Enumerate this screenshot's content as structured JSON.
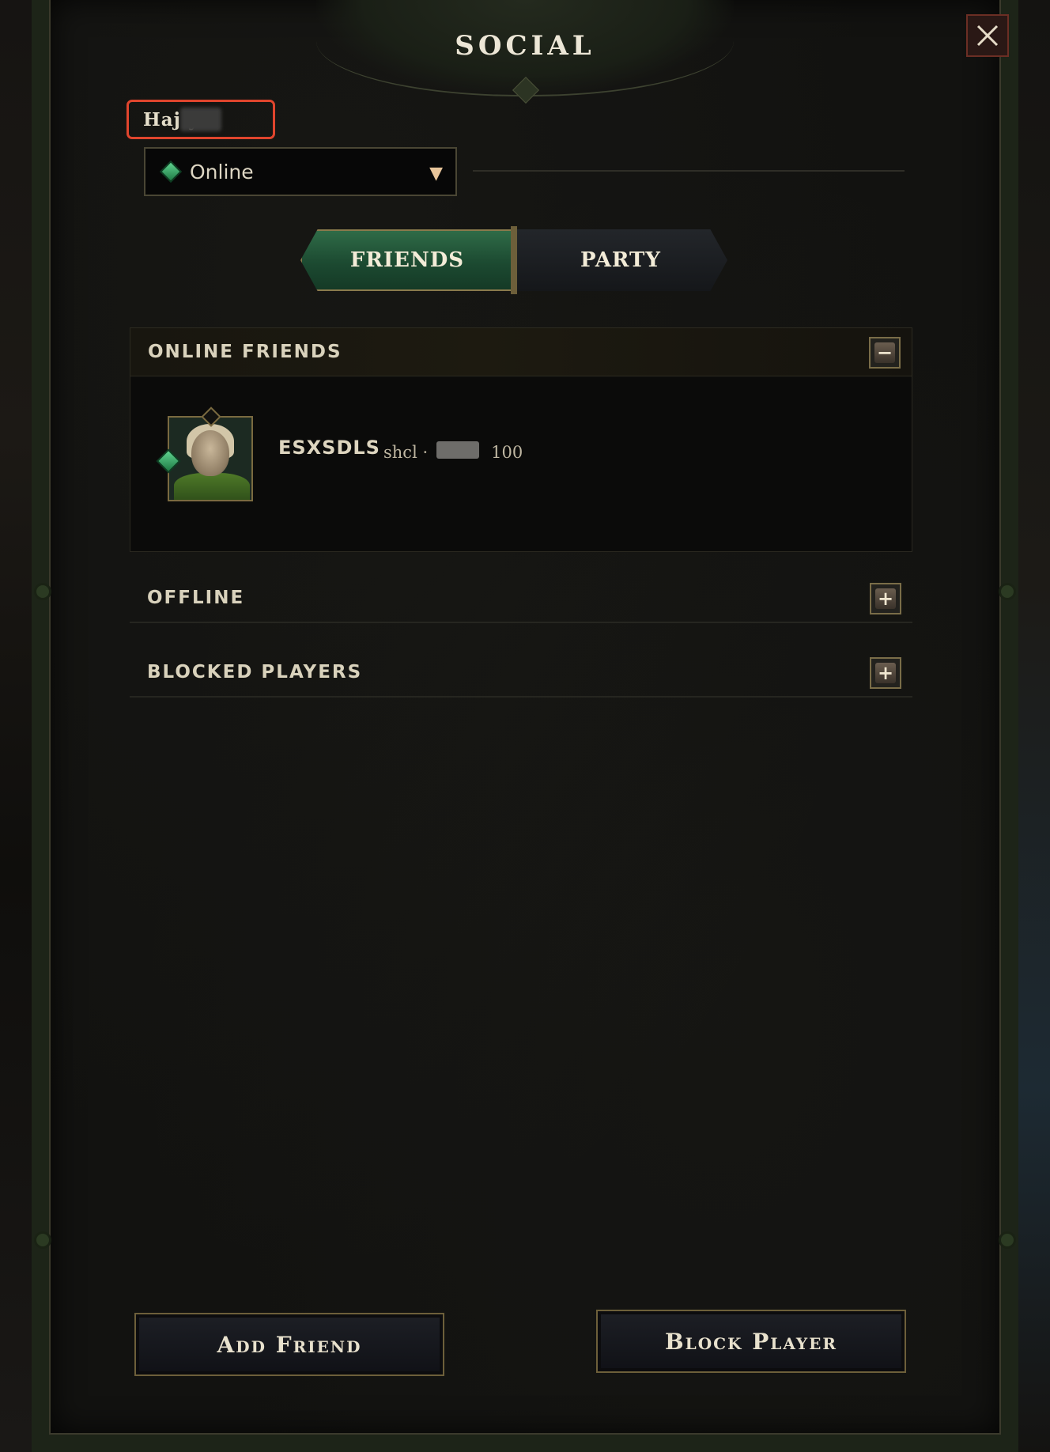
{
  "header": {
    "title": "SOCIAL",
    "close_glyph": "✕"
  },
  "player": {
    "name_visible": "Haj     y"
  },
  "status": {
    "value": "Online",
    "arrow": "▼",
    "icon": "green-gem-icon",
    "color": "#3fbf74"
  },
  "tabs": [
    {
      "label": "FRIENDS",
      "active": true
    },
    {
      "label": "PARTY",
      "active": false
    }
  ],
  "sections": {
    "online": {
      "label": "ONLINE FRIENDS",
      "toggle": "−",
      "expanded": true
    },
    "offline": {
      "label": "OFFLINE",
      "toggle": "+",
      "expanded": false
    },
    "blocked": {
      "label": "BLOCKED PLAYERS",
      "toggle": "+",
      "expanded": false
    }
  },
  "online_friends": [
    {
      "name": "ESXSDLS",
      "detail_prefix": "shcl ·",
      "detail_suffix": "100",
      "status_icon": "green-gem-icon"
    }
  ],
  "actions": {
    "add_friend": "Add Friend",
    "block_player": "Block Player"
  },
  "colors": {
    "accent_green": "#2f6b47",
    "frame_gold": "#7a6a40",
    "highlight_red": "#e0452d"
  }
}
